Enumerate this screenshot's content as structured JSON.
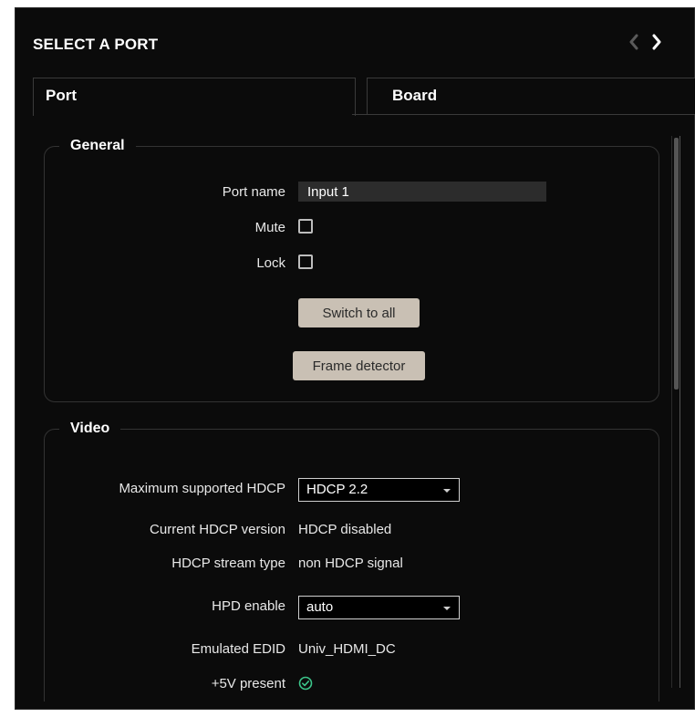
{
  "header": {
    "title": "SELECT A PORT"
  },
  "tabs": [
    {
      "label": "Port"
    },
    {
      "label": "Board"
    }
  ],
  "general": {
    "legend": "General",
    "port_name_label": "Port name",
    "port_name_value": "Input 1",
    "mute_label": "Mute",
    "mute_checked": false,
    "lock_label": "Lock",
    "lock_checked": false,
    "switch_to_all_label": "Switch to all",
    "frame_detector_label": "Frame detector"
  },
  "video": {
    "legend": "Video",
    "max_hdcp_label": "Maximum supported HDCP",
    "max_hdcp_value": "HDCP 2.2",
    "current_hdcp_label": "Current HDCP version",
    "current_hdcp_value": "HDCP disabled",
    "stream_type_label": "HDCP stream type",
    "stream_type_value": "non HDCP signal",
    "hpd_label": "HPD enable",
    "hpd_value": "auto",
    "edid_label": "Emulated EDID",
    "edid_value": "Univ_HDMI_DC",
    "plus5v_label": "+5V present",
    "plus5v_status": "ok"
  },
  "colors": {
    "panel_bg": "#0b0b0b",
    "button_bg": "#c9c0b4",
    "ok_green": "#3cc58a"
  }
}
